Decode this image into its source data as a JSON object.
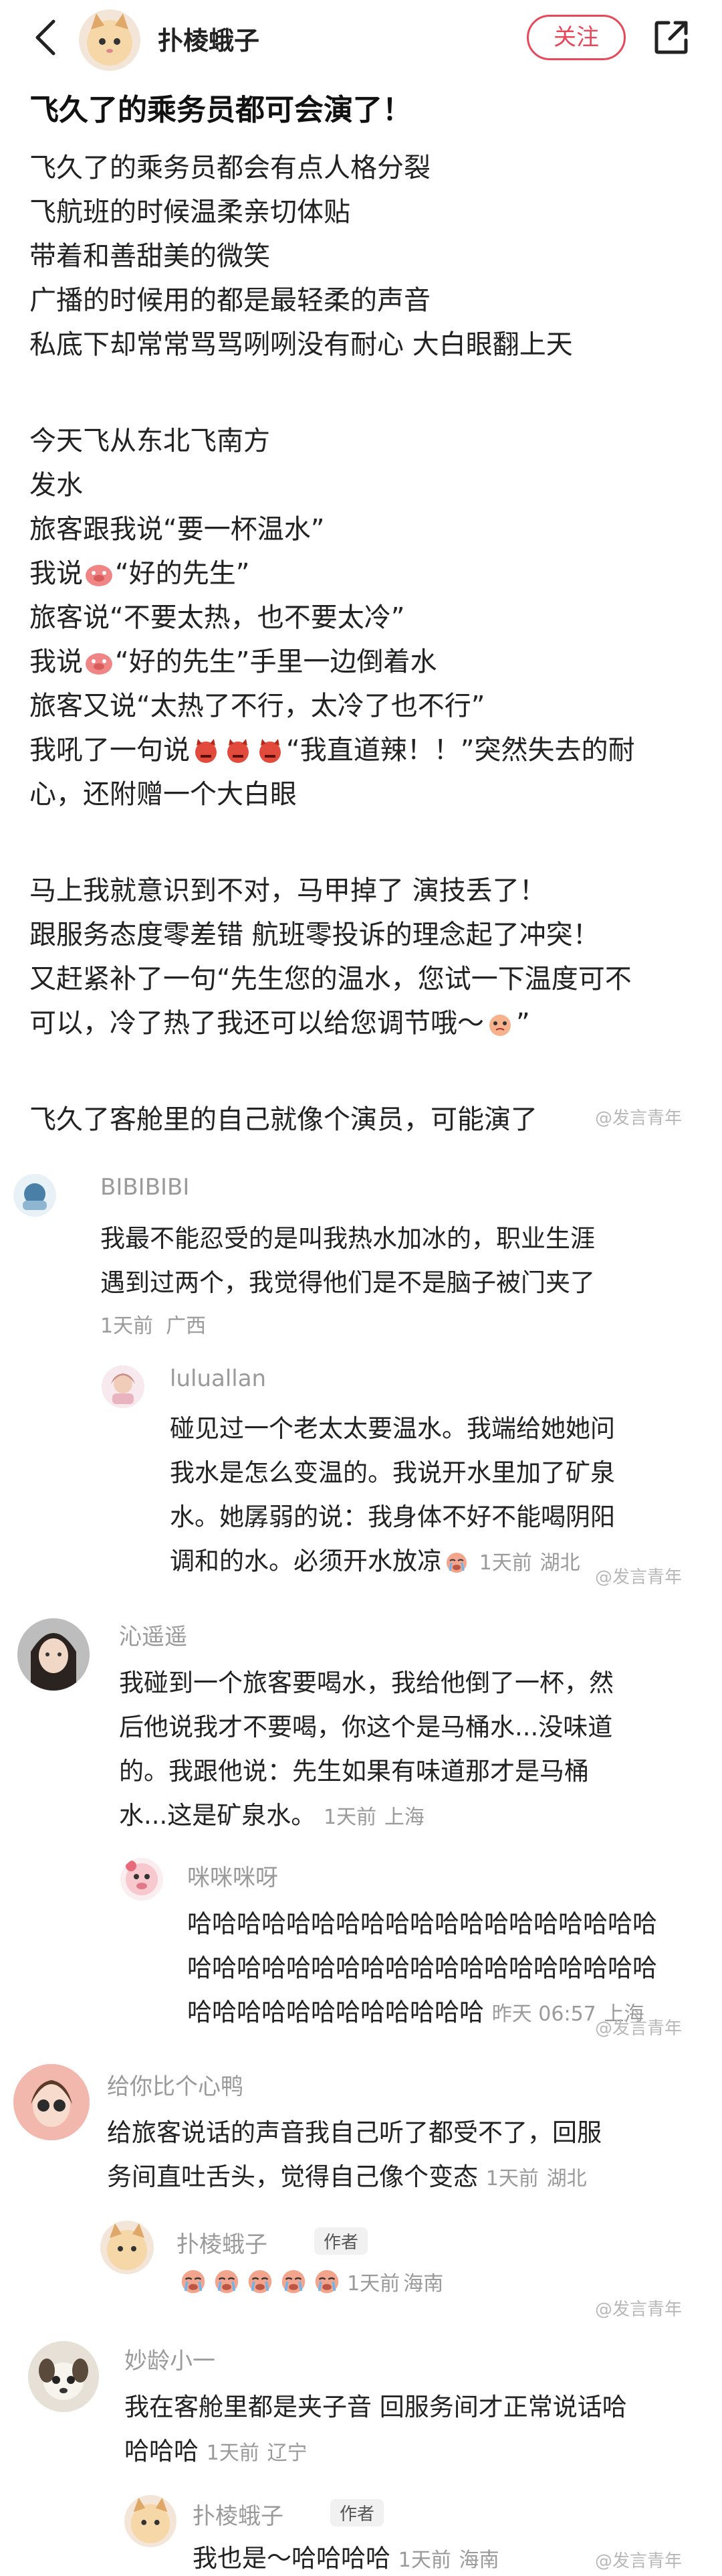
{
  "header": {
    "author": "扑棱蛾子",
    "follow_label": "关注"
  },
  "post": {
    "title": "飞久了的乘务员都可会演了！",
    "lines": [
      "飞久了的乘务员都会有点人格分裂",
      "飞航班的时候温柔亲切体贴",
      "带着和善甜美的微笑",
      "广播的时候用的都是最轻柔的声音",
      "私底下却常常骂骂咧咧没有耐心 大白眼翻上天",
      "今天飞从东北飞南方",
      "发水",
      "旅客跟我说“要一杯温水”",
      "我说",
      "“好的先生”",
      "旅客说“不要太热，也不要太冷”",
      "我说",
      "“好的先生”手里一边倒着水",
      "旅客又说“太热了不行，太冷了也不行”",
      "我吼了一句说",
      "“我直道辣！！”突然失去的耐",
      "心，还附赠一个大白眼",
      "马上我就意识到不对，马甲掉了  演技丢了！",
      "跟服务态度零差错 航班零投诉的理念起了冲突！",
      "又赶紧补了一句“先生您的温水，您试一下温度可不",
      "可以，冷了热了我还可以给您调节哦～",
      "”",
      "飞久了客舱里的自己就像个演员，可能演了"
    ]
  },
  "watermark": "@发言青年",
  "comments": [
    {
      "name": "BIBIBIBI",
      "lines": [
        "我最不能忍受的是叫我热水加冰的，职业生涯",
        "遇到过两个，我觉得他们是不是脑子被门夹了"
      ],
      "time": "1天前",
      "loc": "广西"
    },
    {
      "name": "luluallan",
      "lines": [
        "碰见过一个老太太要温水。我端给她她问",
        "我水是怎么变温的。我说开水里加了矿泉",
        "水。她孱弱的说：我身体不好不能喝阴阳",
        "调和的水。必须开水放凉"
      ],
      "time": "1天前",
      "loc": "湖北"
    },
    {
      "name": "沁遥遥",
      "lines": [
        "我碰到一个旅客要喝水，我给他倒了一杯，然",
        "后他说我才不要喝，你这个是马桶水...没味道",
        "的。我跟他说：先生如果有味道那才是马桶",
        "水...这是矿泉水。"
      ],
      "time": "1天前",
      "loc": "上海"
    },
    {
      "name": "咪咪咪呀",
      "lines": [
        "哈哈哈哈哈哈哈哈哈哈哈哈哈哈哈哈哈哈哈",
        "哈哈哈哈哈哈哈哈哈哈哈哈哈哈哈哈哈哈哈",
        "哈哈哈哈哈哈哈哈哈哈哈哈"
      ],
      "time": "昨天 06:57",
      "loc": "上海"
    },
    {
      "name": "给你比个心鸭",
      "lines": [
        "给旅客说话的声音我自己听了都受不了，回服",
        "务间直吐舌头，觉得自己像个变态"
      ],
      "time": "1天前",
      "loc": "湖北"
    },
    {
      "name": "扑棱蛾子",
      "badge": "作者",
      "time": "1天前",
      "loc": "海南"
    },
    {
      "name": "妙龄小一",
      "lines": [
        "我在客舱里都是夹子音 回服务间才正常说话哈",
        "哈哈哈"
      ],
      "time": "1天前",
      "loc": "辽宁"
    },
    {
      "name": "扑棱蛾子",
      "badge": "作者",
      "lines": [
        "我也是～哈哈哈哈"
      ],
      "time": "1天前",
      "loc": "海南"
    }
  ]
}
